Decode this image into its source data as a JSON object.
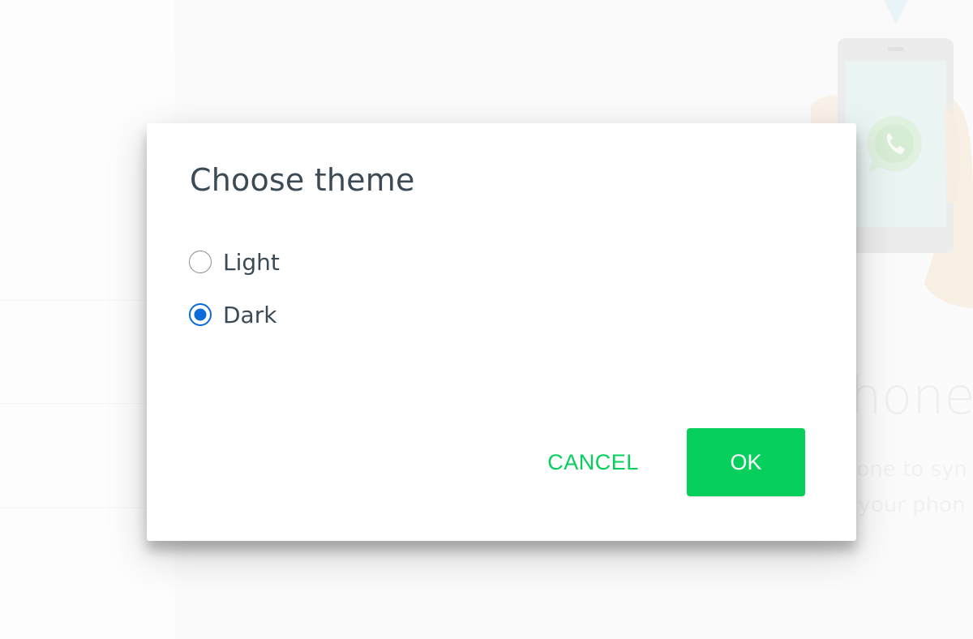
{
  "background": {
    "heading_fragment": "hone",
    "line1_fragment": "hone to syn",
    "line2_fragment": "t your phon"
  },
  "dialog": {
    "title": "Choose theme",
    "options": [
      {
        "label": "Light",
        "selected": false
      },
      {
        "label": "Dark",
        "selected": true
      }
    ],
    "cancel_label": "CANCEL",
    "ok_label": "OK"
  },
  "colors": {
    "accent_green": "#06cf5c",
    "radio_blue": "#0b6bd8",
    "text_dark": "#3b4a54"
  },
  "icons": {
    "background_logo": "whatsapp-logo-icon",
    "background_phone": "phone-illustration-icon"
  }
}
